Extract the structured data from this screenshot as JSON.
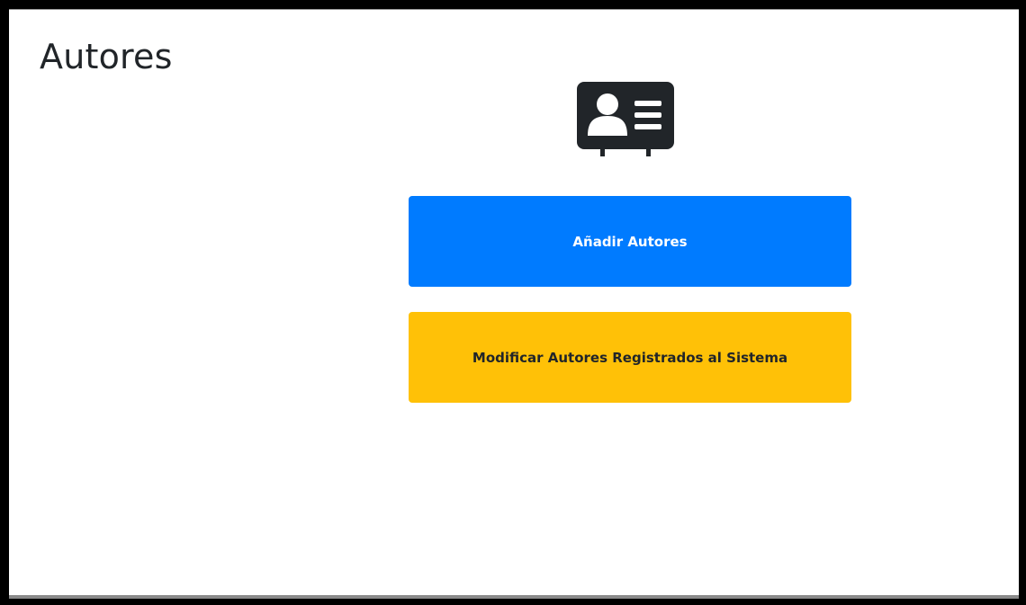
{
  "page": {
    "title": "Autores"
  },
  "icon": {
    "name": "address-card-icon",
    "color": "#212529"
  },
  "buttons": {
    "add_label": "Añadir Autores",
    "modify_label": "Modificar Autores Registrados al Sistema"
  },
  "colors": {
    "primary": "#007bff",
    "warning": "#ffc107",
    "frame": "#000000"
  }
}
